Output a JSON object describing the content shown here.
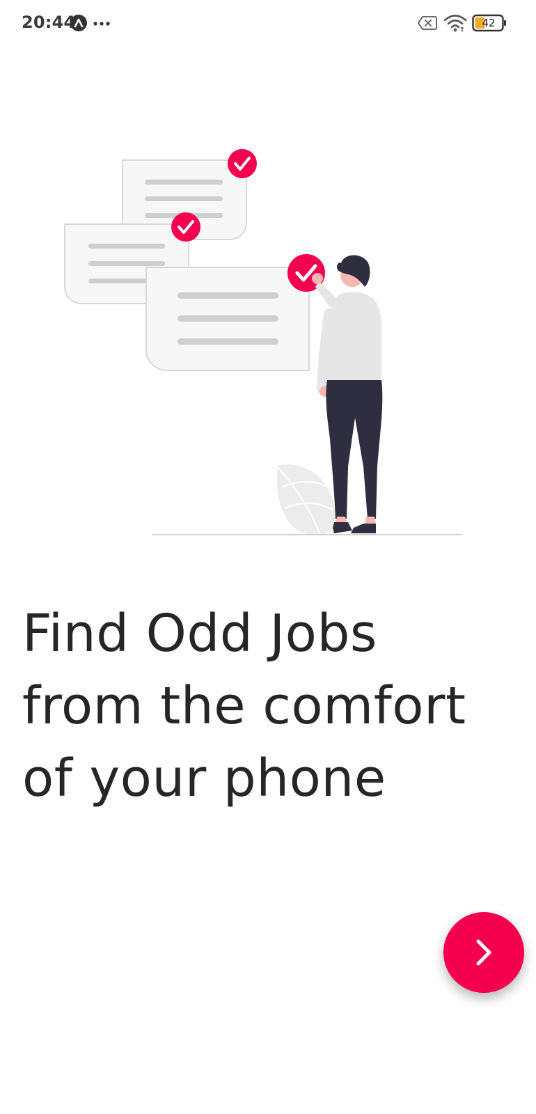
{
  "status_bar": {
    "time": "20:44",
    "battery_level": "42",
    "app_icon": "app-icon",
    "more_icon": "more-dots-icon",
    "sim_icon": "no-sim-icon",
    "wifi_icon": "wifi-icon",
    "battery_icon": "battery-icon"
  },
  "onboarding": {
    "headline_lines": [
      "Find Odd Jobs",
      "from the comfort",
      "of your phone"
    ],
    "next_icon": "chevron-right-icon"
  },
  "colors": {
    "accent": "#f5004f",
    "text": "#262626",
    "card_line": "#cfcfcf",
    "pants": "#2f2e41",
    "shirt": "#e6e6e6"
  }
}
